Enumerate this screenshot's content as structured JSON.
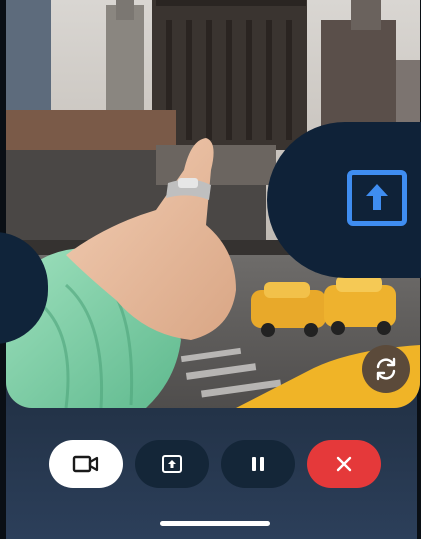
{
  "preview": {
    "scene": "city-street-pointing-hand"
  },
  "share_panel": {
    "icon": "screen-share-icon",
    "accent": "#3f8df0",
    "background": "#0f2238"
  },
  "controls": {
    "camera_button": {
      "icon": "video-camera-icon",
      "background": "#ffffff"
    },
    "share_button": {
      "icon": "screen-share-icon",
      "background": "#142638"
    },
    "pause_button": {
      "icon": "pause-icon",
      "background": "#142638"
    },
    "end_button": {
      "icon": "close-icon",
      "background": "#e5393a"
    }
  },
  "flip_camera": {
    "icon": "flip-camera-icon"
  }
}
